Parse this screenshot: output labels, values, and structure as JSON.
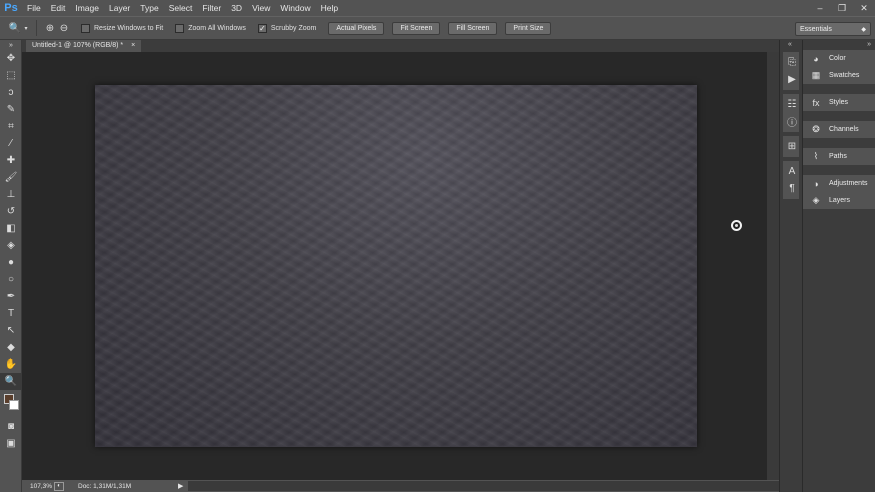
{
  "app": {
    "logo": "Ps"
  },
  "menu": [
    "File",
    "Edit",
    "Image",
    "Layer",
    "Type",
    "Select",
    "Filter",
    "3D",
    "View",
    "Window",
    "Help"
  ],
  "window_controls": [
    "–",
    "❐",
    "✕"
  ],
  "options": {
    "checkboxes": [
      {
        "label": "Resize Windows to Fit",
        "checked": false
      },
      {
        "label": "Zoom All Windows",
        "checked": false
      },
      {
        "label": "Scrubby Zoom",
        "checked": true
      }
    ],
    "buttons": [
      "Actual Pixels",
      "Fit Screen",
      "Fill Screen",
      "Print Size"
    ],
    "workspace": "Essentials"
  },
  "document": {
    "tab_title": "Untitled-1 @ 107% (RGB/8) *",
    "close": "×"
  },
  "status": {
    "zoom": "107,3%",
    "doc_info": "Doc: 1,31M/1,31M",
    "arrow": "▶"
  },
  "colors": {
    "foreground": "#5a3e2c",
    "background": "#ffffff",
    "chalkboard": "#413f47"
  },
  "panels": [
    {
      "group": [
        {
          "label": "Color",
          "icon": "color-wheel-icon"
        },
        {
          "label": "Swatches",
          "icon": "grid-icon"
        }
      ]
    },
    {
      "group": [
        {
          "label": "Styles",
          "icon": "styles-icon"
        }
      ]
    },
    {
      "group": [
        {
          "label": "Channels",
          "icon": "channels-icon"
        }
      ]
    },
    {
      "group": [
        {
          "label": "Paths",
          "icon": "paths-icon"
        }
      ]
    },
    {
      "group": [
        {
          "label": "Adjustments",
          "icon": "adjust-icon"
        },
        {
          "label": "Layers",
          "icon": "layers-icon"
        }
      ]
    }
  ]
}
